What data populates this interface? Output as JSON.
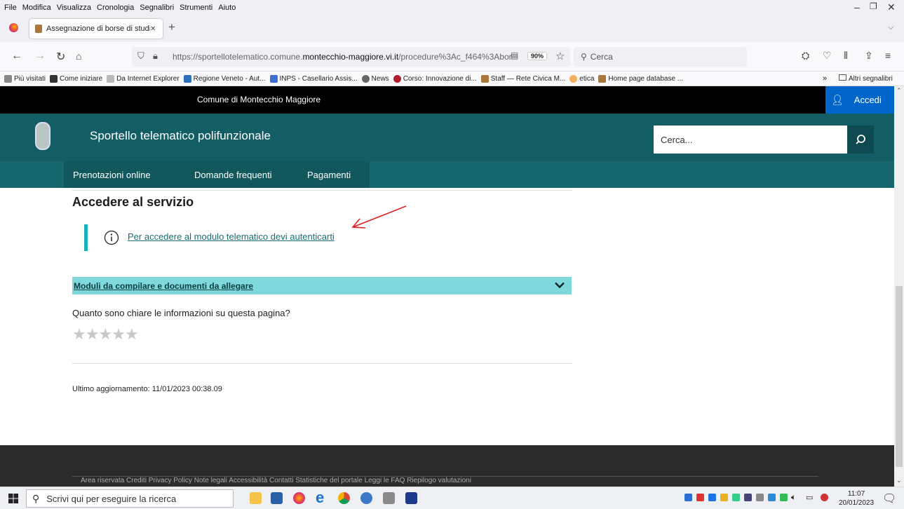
{
  "browser": {
    "menu": [
      "File",
      "Modifica",
      "Visualizza",
      "Cronologia",
      "Segnalibri",
      "Strumenti",
      "Aiuto"
    ],
    "tab_title": "Assegnazione di borse di studio",
    "new_tab": "+",
    "url_prefix": "https://sportellotelematico.comune.",
    "url_domain": "montecchio-maggiore.vi.it",
    "url_path": "/procedure%3Ac_f464%3Abor",
    "zoom": "90%",
    "search_placeholder": "Cerca",
    "bookmarks": [
      {
        "label": "Più visitati",
        "color": "#888"
      },
      {
        "label": "Come iniziare",
        "color": "#333"
      },
      {
        "label": "Da Internet Explorer",
        "color": "#bbb"
      },
      {
        "label": "Regione Veneto - Aut...",
        "color": "#2f6fbf"
      },
      {
        "label": "INPS - Casellario Assis...",
        "color": "#3c6fd1"
      },
      {
        "label": "News",
        "color": "#666"
      },
      {
        "label": "Corso: Innovazione di...",
        "color": "#b01c2e"
      },
      {
        "label": "Staff — Rete Civica M...",
        "color": "#a7783a"
      },
      {
        "label": "etica",
        "color": "#f0b060"
      },
      {
        "label": "Home page database ...",
        "color": "#a7783a"
      }
    ],
    "other_bookmarks": "Altri segnalibri",
    "overflow": "»"
  },
  "site": {
    "municipality": "Comune di Montecchio Maggiore",
    "login_label": "Accedi",
    "title": "Sportello telematico polifunzionale",
    "search_placeholder": "Cerca...",
    "nav": [
      "Prenotazioni online",
      "Domande frequenti",
      "Pagamenti"
    ]
  },
  "main": {
    "heading": "Accedere al servizio",
    "info_link": "Per accedere al modulo telematico devi autenticarti",
    "accordion_label": "Moduli da compilare e documenti da allegare",
    "rating_question": "Quanto sono chiare le informazioni su questa pagina?",
    "stars_filled": 0,
    "stars_total": 5,
    "last_update": "Ultimo aggiornamento: 11/01/2023 00:38.09"
  },
  "footer": {
    "links": "Area riservata     Crediti     Privacy Policy     Note legali     Accessibilità     Contatti     Statistiche del portale     Leggi le FAQ     Riepilogo valutazioni"
  },
  "taskbar": {
    "search_placeholder": "Scrivi qui per eseguire la ricerca",
    "time": "11:07",
    "date": "20/01/2023"
  },
  "colors": {
    "header_teal": "#125e64",
    "nav_teal": "#16686e",
    "accordion": "#7fd8dc",
    "info_bar": "#17b3b7",
    "login_blue": "#0066cc",
    "annotation_arrow": "#e02020"
  }
}
